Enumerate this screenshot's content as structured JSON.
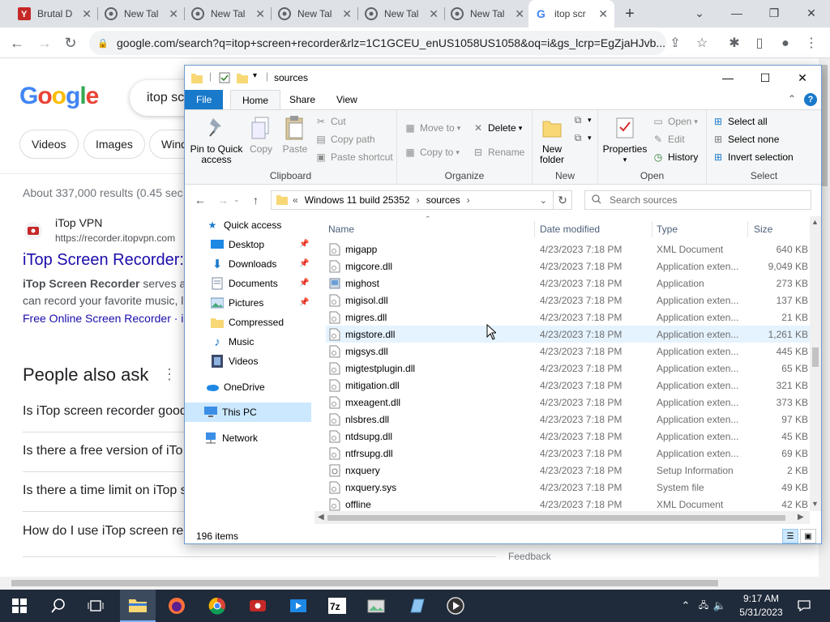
{
  "browser": {
    "tabs": [
      {
        "title": "Brutal D",
        "icon": "brutal-icon"
      },
      {
        "title": "New Tal",
        "icon": "chrome-icon"
      },
      {
        "title": "New Tal",
        "icon": "chrome-icon"
      },
      {
        "title": "New Tal",
        "icon": "chrome-icon"
      },
      {
        "title": "New Tal",
        "icon": "chrome-icon"
      },
      {
        "title": "New Tal",
        "icon": "chrome-icon"
      },
      {
        "title": "itop scr",
        "icon": "google-icon",
        "active": true
      }
    ],
    "url": "google.com/search?q=itop+screen+recorder&rlz=1C1GCEU_enUS1058US1058&oq=i&gs_lcrp=EgZjaHJvb..."
  },
  "google": {
    "logo": "Google",
    "query": "itop sc",
    "chips": [
      "Videos",
      "Images",
      "Wind"
    ],
    "stats": "About 337,000 results (0.45 sec",
    "result": {
      "site": "iTop VPN",
      "url": "https://recorder.itopvpn.com",
      "title": "iTop Screen Recorder:",
      "snippet_bold": "iTop Screen Recorder",
      "snippet_rest": " serves a",
      "snippet2": "can record your favorite music, l",
      "link": "Free Online Screen Recorder · i"
    },
    "paa": "People also ask",
    "questions": [
      "Is iTop screen recorder good",
      "Is there a free version of iTo",
      "Is there a time limit on iTop s",
      "How do I use iTop screen re"
    ],
    "feedback": "Feedback"
  },
  "explorer": {
    "title": "sources",
    "tabs": {
      "file": "File",
      "home": "Home",
      "share": "Share",
      "view": "View"
    },
    "ribbon": {
      "pin": "Pin to Quick access",
      "copy": "Copy",
      "paste": "Paste",
      "cut": "Cut",
      "copy_path": "Copy path",
      "paste_shortcut": "Paste shortcut",
      "clipboard": "Clipboard",
      "move_to": "Move to",
      "copy_to": "Copy to",
      "delete": "Delete",
      "rename": "Rename",
      "organize": "Organize",
      "new_folder": "New folder",
      "new": "New",
      "properties": "Properties",
      "open": "Open",
      "edit": "Edit",
      "history": "History",
      "open_group": "Open",
      "select_all": "Select all",
      "select_none": "Select none",
      "invert_selection": "Invert selection",
      "select": "Select"
    },
    "address": {
      "crumb_prefix": "«",
      "crumb1": "Windows 11 build 25352",
      "crumb2": "sources",
      "search_placeholder": "Search sources"
    },
    "nav": {
      "quick_access": "Quick access",
      "desktop": "Desktop",
      "downloads": "Downloads",
      "documents": "Documents",
      "pictures": "Pictures",
      "compressed": "Compressed",
      "music": "Music",
      "videos": "Videos",
      "onedrive": "OneDrive",
      "this_pc": "This PC",
      "network": "Network"
    },
    "columns": {
      "name": "Name",
      "date": "Date modified",
      "type": "Type",
      "size": "Size"
    },
    "files": [
      {
        "name": "migapp",
        "date": "4/23/2023 7:18 PM",
        "type": "XML Document",
        "size": "640 KB"
      },
      {
        "name": "migcore.dll",
        "date": "4/23/2023 7:18 PM",
        "type": "Application exten...",
        "size": "9,049 KB"
      },
      {
        "name": "mighost",
        "date": "4/23/2023 7:18 PM",
        "type": "Application",
        "size": "273 KB"
      },
      {
        "name": "migisol.dll",
        "date": "4/23/2023 7:18 PM",
        "type": "Application exten...",
        "size": "137 KB"
      },
      {
        "name": "migres.dll",
        "date": "4/23/2023 7:18 PM",
        "type": "Application exten...",
        "size": "21 KB"
      },
      {
        "name": "migstore.dll",
        "date": "4/23/2023 7:18 PM",
        "type": "Application exten...",
        "size": "1,261 KB"
      },
      {
        "name": "migsys.dll",
        "date": "4/23/2023 7:18 PM",
        "type": "Application exten...",
        "size": "445 KB"
      },
      {
        "name": "migtestplugin.dll",
        "date": "4/23/2023 7:18 PM",
        "type": "Application exten...",
        "size": "65 KB"
      },
      {
        "name": "mitigation.dll",
        "date": "4/23/2023 7:18 PM",
        "type": "Application exten...",
        "size": "321 KB"
      },
      {
        "name": "mxeagent.dll",
        "date": "4/23/2023 7:18 PM",
        "type": "Application exten...",
        "size": "373 KB"
      },
      {
        "name": "nlsbres.dll",
        "date": "4/23/2023 7:18 PM",
        "type": "Application exten...",
        "size": "97 KB"
      },
      {
        "name": "ntdsupg.dll",
        "date": "4/23/2023 7:18 PM",
        "type": "Application exten...",
        "size": "45 KB"
      },
      {
        "name": "ntfrsupg.dll",
        "date": "4/23/2023 7:18 PM",
        "type": "Application exten...",
        "size": "69 KB"
      },
      {
        "name": "nxquery",
        "date": "4/23/2023 7:18 PM",
        "type": "Setup Information",
        "size": "2 KB"
      },
      {
        "name": "nxquery.sys",
        "date": "4/23/2023 7:18 PM",
        "type": "System file",
        "size": "49 KB"
      },
      {
        "name": "offline",
        "date": "4/23/2023 7:18 PM",
        "type": "XML Document",
        "size": "42 KB"
      }
    ],
    "status": "196 items"
  },
  "taskbar": {
    "time": "9:17 AM",
    "date": "5/31/2023"
  },
  "colors": {
    "accent": "#1979ca",
    "link": "#1a0dab",
    "taskbar": "#1f2a3a"
  }
}
